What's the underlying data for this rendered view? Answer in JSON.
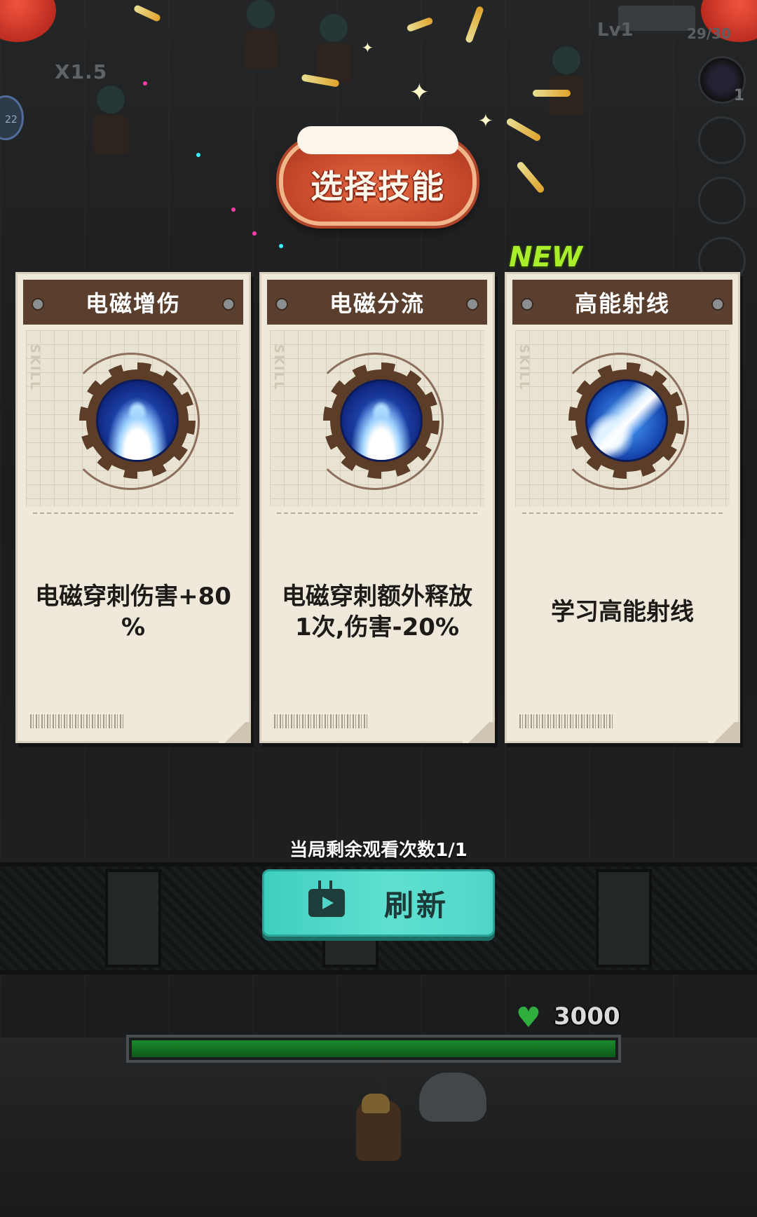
{
  "hud": {
    "speed": "X1.5",
    "round_badge": "22",
    "level": "Lv1",
    "ammo": "29/30",
    "skill_slot_count": "1"
  },
  "title": "选择技能",
  "new_tag": "NEW",
  "cards": [
    {
      "name": "电磁增伤",
      "watermark": "SKILL",
      "icon": "electromagnetic-pierce-icon",
      "description": "电磁穿刺伤害+80%"
    },
    {
      "name": "电磁分流",
      "watermark": "SKILL",
      "icon": "electromagnetic-pierce-icon",
      "description": "电磁穿刺额外释放1次,伤害-20%"
    },
    {
      "name": "高能射线",
      "watermark": "SKILL",
      "icon": "energy-beam-icon",
      "description": "学习高能射线",
      "is_new": true
    }
  ],
  "refresh": {
    "remaining_text": "当局剩余观看次数1/1",
    "button_label": "刷新",
    "icon": "tv-ad-icon"
  },
  "player": {
    "hp": "3000",
    "hp_fraction": 1.0
  },
  "colors": {
    "card_header": "#5a3f2e",
    "refresh_button": "#4fd6c8",
    "new_tag": "#a9ee2a",
    "hp_bar": "#1a8a2a",
    "title_badge": "#c94a2c"
  }
}
